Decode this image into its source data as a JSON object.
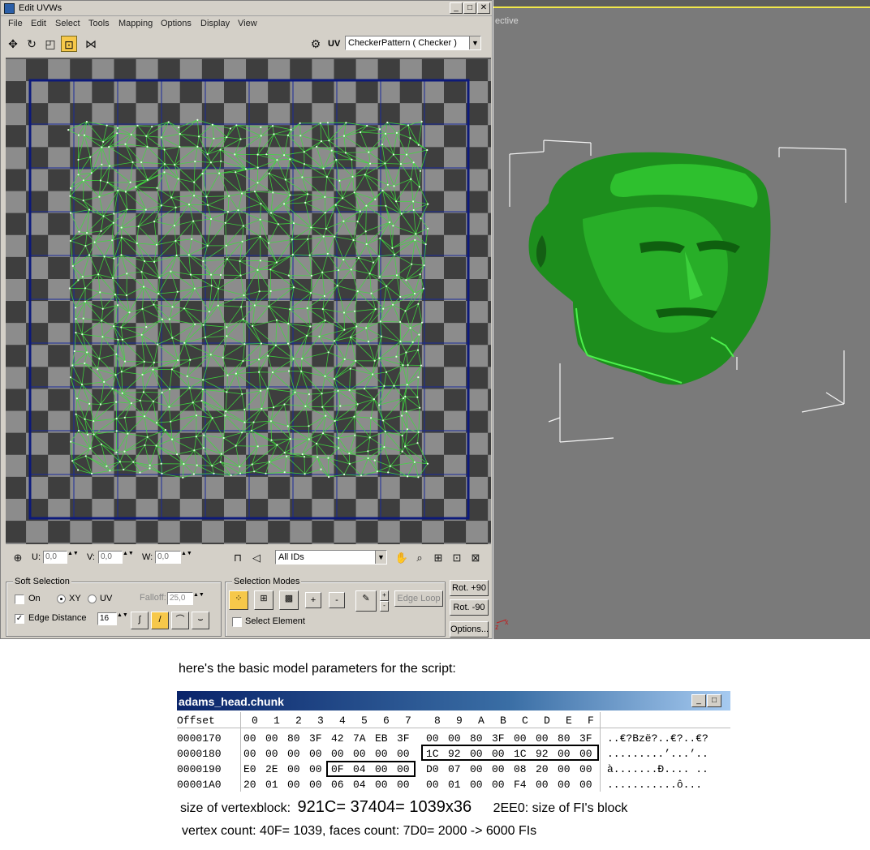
{
  "window": {
    "title": "Edit UVWs",
    "buttons": {
      "minimize": "_",
      "maximize": "□",
      "close": "✕"
    }
  },
  "menu": [
    "File",
    "Edit",
    "Select",
    "Tools",
    "Mapping",
    "Options",
    "Display",
    "View"
  ],
  "toolbar": {
    "tools": [
      "move-icon",
      "rotate-icon",
      "scale-icon",
      "freeform-icon",
      "mirror-icon"
    ],
    "uv_label": "UV",
    "texture_select": "CheckerPattern  ( Checker )"
  },
  "uv_bottom_bar": {
    "u_label": "U:",
    "u_value": "0,0",
    "v_label": "V:",
    "v_value": "0,0",
    "w_label": "W:",
    "w_value": "0,0",
    "ids_select": "All IDs"
  },
  "soft_selection": {
    "title": "Soft Selection",
    "on_label": "On",
    "on_checked": false,
    "xy_label": "XY",
    "uv_label": "UV",
    "selected_mode": "XY",
    "falloff_label": "Falloff:",
    "falloff_value": "25,0",
    "edge_distance_label": "Edge Distance",
    "edge_distance_checked": true,
    "edge_distance_value": "16"
  },
  "selection_modes": {
    "title": "Selection Modes",
    "plus_label": "+",
    "minus_label": "-",
    "edge_loop_label": "Edge Loop",
    "select_element_label": "Select Element",
    "select_element_checked": false
  },
  "rot_buttons": {
    "rot_plus": "Rot. +90",
    "rot_minus": "Rot. -90",
    "options": "Options..."
  },
  "viewport": {
    "label": "ective"
  },
  "caption": "here's the basic model parameters for the script:",
  "hex": {
    "title": "adams_head.chunk",
    "header_offset": "Offset",
    "header_cols": [
      "0",
      "1",
      "2",
      "3",
      "4",
      "5",
      "6",
      "7",
      "8",
      "9",
      "A",
      "B",
      "C",
      "D",
      "E",
      "F"
    ],
    "rows": [
      {
        "offset": "0000170",
        "bytes": [
          "00",
          "00",
          "80",
          "3F",
          "42",
          "7A",
          "EB",
          "3F",
          "00",
          "00",
          "80",
          "3F",
          "00",
          "00",
          "80",
          "3F"
        ],
        "ascii": "..€?Bzë?..€?..€?"
      },
      {
        "offset": "0000180",
        "bytes": [
          "00",
          "00",
          "00",
          "00",
          "00",
          "00",
          "00",
          "00",
          "1C",
          "92",
          "00",
          "00",
          "1C",
          "92",
          "00",
          "00"
        ],
        "ascii": ".........’...’.."
      },
      {
        "offset": "0000190",
        "bytes": [
          "E0",
          "2E",
          "00",
          "00",
          "0F",
          "04",
          "00",
          "00",
          "D0",
          "07",
          "00",
          "00",
          "08",
          "20",
          "00",
          "00"
        ],
        "ascii": "à.......Ð.... .."
      },
      {
        "offset": "00001A0",
        "bytes": [
          "20",
          "01",
          "00",
          "00",
          "06",
          "04",
          "00",
          "00",
          "00",
          "01",
          "00",
          "00",
          "F4",
          "00",
          "00",
          "00"
        ],
        "ascii": " ...........ô..."
      }
    ]
  },
  "notes": {
    "line1_label": "size of vertexblock:",
    "line1_value": "921C= 37404= 1039x36",
    "line1_extra": "2EE0: size of FI's block",
    "line2": "vertex count: 40F= 1039, faces count: 7D0= 2000  -> 6000 FIs"
  },
  "colors": {
    "uv_mesh": "#3ddc3d",
    "head": "#1f9a1f",
    "panel": "#d4d0c8",
    "viewport_bg": "#7a7a7a",
    "hex_title_bar": "#0a246a"
  }
}
